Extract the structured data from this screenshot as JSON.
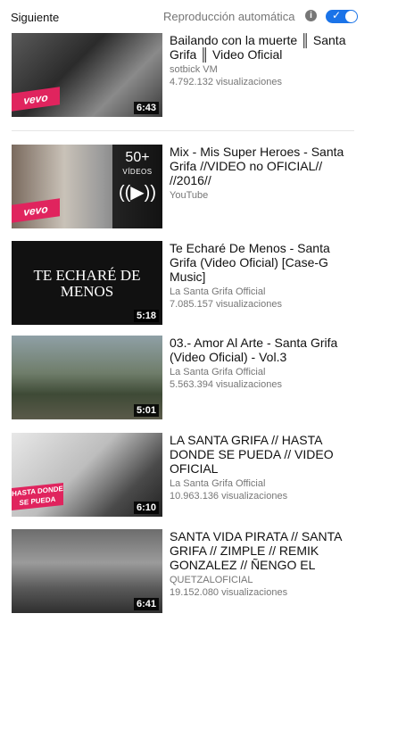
{
  "header": {
    "next_label": "Siguiente",
    "autoplay_label": "Reproducción automática",
    "autoplay_on": true
  },
  "videos": [
    {
      "title": "Bailando con la muerte ║ Santa Grifa ║ Video Oficial",
      "channel": "sotbick VM",
      "views": "4.792.132 visualizaciones",
      "duration": "6:43",
      "badge": "vevo"
    },
    {
      "title": "Mix - Mis Super Heroes - Santa Grifa //VIDEO no OFICIAL// //2016//",
      "channel": "YouTube",
      "views": "",
      "mix_count": "50+",
      "mix_label": "VÍDEOS",
      "badge": "vevo"
    },
    {
      "title": "Te Echaré De Menos - Santa Grifa (Video Oficial) [Case-G Music]",
      "channel": "La Santa Grifa Official",
      "views": "7.085.157 visualizaciones",
      "duration": "5:18",
      "thumb_text": "TE ECHARÉ DE MENOS"
    },
    {
      "title": "03.- Amor Al Arte - Santa Grifa (Video Oficial) - Vol.3",
      "channel": "La Santa Grifa Official",
      "views": "5.563.394 visualizaciones",
      "duration": "5:01"
    },
    {
      "title": "LA SANTA GRIFA // HASTA DONDE SE PUEDA // VIDEO OFICIAL",
      "channel": "La Santa Grifa Official",
      "views": "10.963.136 visualizaciones",
      "duration": "6:10",
      "thumb_badge": "HASTA DONDE SE PUEDA"
    },
    {
      "title": "SANTA VIDA PIRATA // SANTA GRIFA // ZIMPLE // REMIK GONZALEZ // ÑENGO EL",
      "channel": "QUETZALOFICIAL",
      "views": "19.152.080 visualizaciones",
      "duration": "6:41"
    }
  ],
  "colors": {
    "accent": "#1a73e8",
    "vevo": "#e0245e",
    "meta_text": "#767676"
  }
}
